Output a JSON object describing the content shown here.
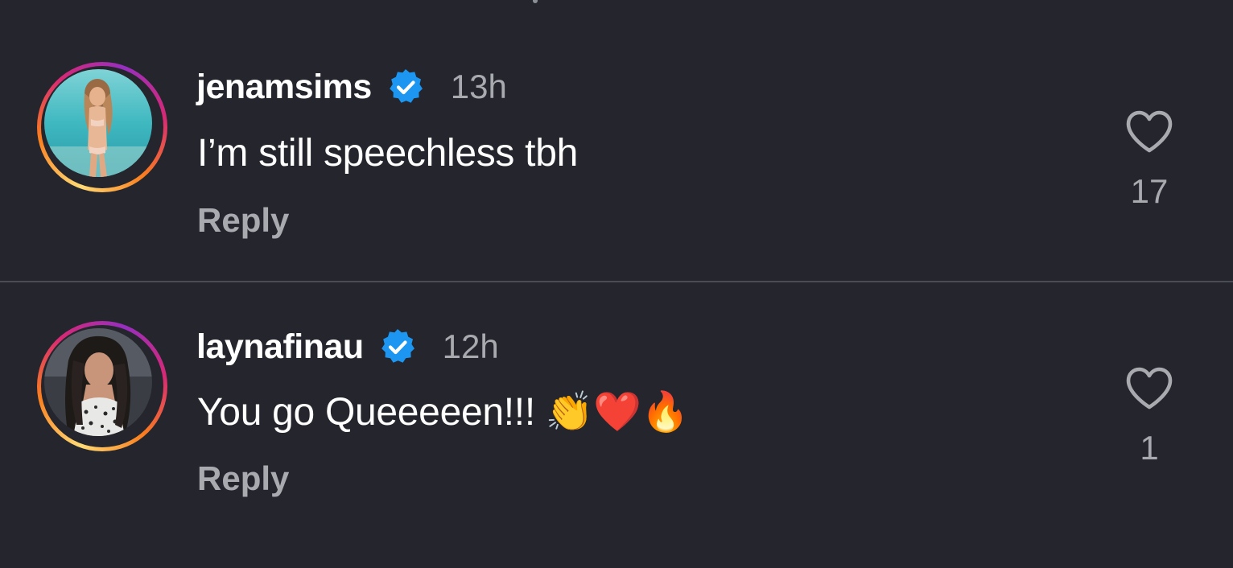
{
  "comments": [
    {
      "username": "jenamsims",
      "verified": true,
      "timestamp": "13h",
      "text": "I’m still speechless tbh",
      "reply_label": "Reply",
      "like_count": "17",
      "avatar_icon": "avatar-photo-beach"
    },
    {
      "username": "laynafinau",
      "verified": true,
      "timestamp": "12h",
      "text": "You go Queeeeen!!! 👏❤️🔥",
      "reply_label": "Reply",
      "like_count": "1",
      "avatar_icon": "avatar-photo-portrait"
    }
  ],
  "colors": {
    "background": "#24252d",
    "verified_blue": "#1c96f0",
    "muted_text": "#a8aab0",
    "divider": "#4a4c55",
    "story_ring_start": "#feda75",
    "story_ring_end": "#d62976"
  },
  "icons": {
    "verified": "verified-badge-icon",
    "like": "heart-outline-icon"
  }
}
